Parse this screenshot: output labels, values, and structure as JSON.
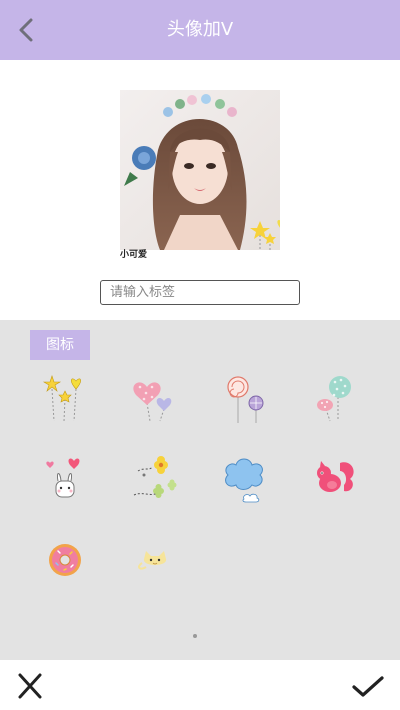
{
  "header": {
    "title": "头像加V",
    "back_icon": "chevron-left-icon"
  },
  "preview": {
    "label": "小可爱"
  },
  "tag_input": {
    "placeholder": "请输入标签",
    "value": ""
  },
  "sticker_panel": {
    "tab_label": "图标",
    "stickers": [
      {
        "name": "star-balloons-sticker"
      },
      {
        "name": "heart-balloons-sticker"
      },
      {
        "name": "lollipop-sticker"
      },
      {
        "name": "polka-dot-balloons-sticker"
      },
      {
        "name": "bunny-hearts-sticker"
      },
      {
        "name": "flower-doodle-sticker"
      },
      {
        "name": "blue-cloud-sticker"
      },
      {
        "name": "pink-squirrel-sticker"
      },
      {
        "name": "donut-sticker"
      },
      {
        "name": "yellow-cat-sticker"
      }
    ]
  },
  "bottom_bar": {
    "cancel_icon": "close-icon",
    "confirm_icon": "checkmark-icon"
  },
  "colors": {
    "accent": "#c5b5e8",
    "panel_bg": "#e3e3e3",
    "text_dark": "#222222"
  }
}
